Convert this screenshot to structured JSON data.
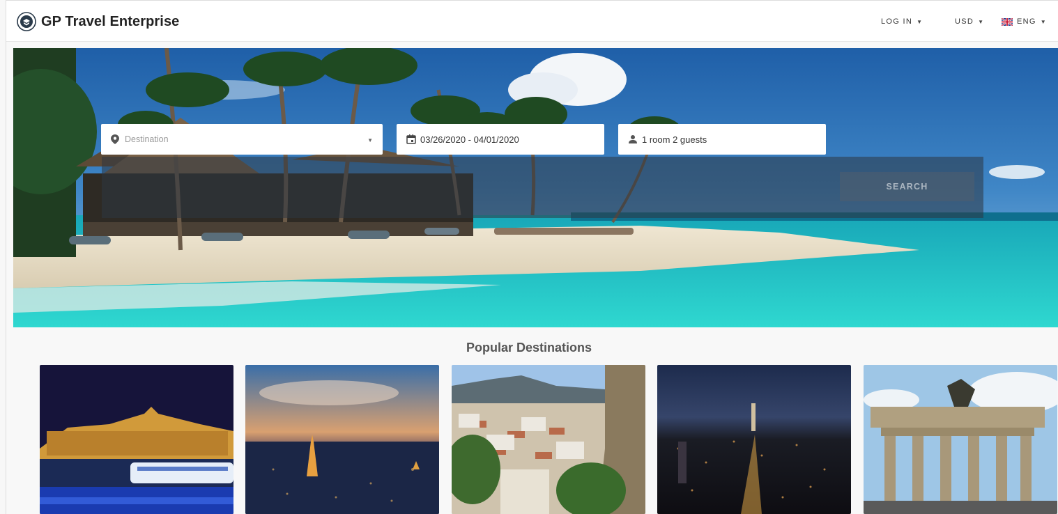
{
  "brand": {
    "name": "GP Travel Enterprise",
    "logo_icon": "globe-logo-icon"
  },
  "header": {
    "login_label": "LOG IN",
    "currency_label": "USD",
    "language_label": "ENG",
    "language_flag": "uk-flag-icon"
  },
  "search": {
    "destination_placeholder": "Destination",
    "date_range": "03/26/2020 - 04/01/2020",
    "guests": "1 room 2 guests",
    "button_label": "SEARCH"
  },
  "destinations": {
    "title": "Popular Destinations",
    "cards": [
      {
        "image": "budapest-night-castle-river"
      },
      {
        "image": "paris-eiffel-tower-dusk"
      },
      {
        "image": "greek-town-hillside"
      },
      {
        "image": "new-york-night-skyline"
      },
      {
        "image": "berlin-brandenburg-gate"
      }
    ]
  },
  "colors": {
    "hero_sky": "#3d7fbf",
    "hero_sea": "#27c6c6",
    "search_band": "#2d3741",
    "page_bg": "#f8f8f8"
  }
}
